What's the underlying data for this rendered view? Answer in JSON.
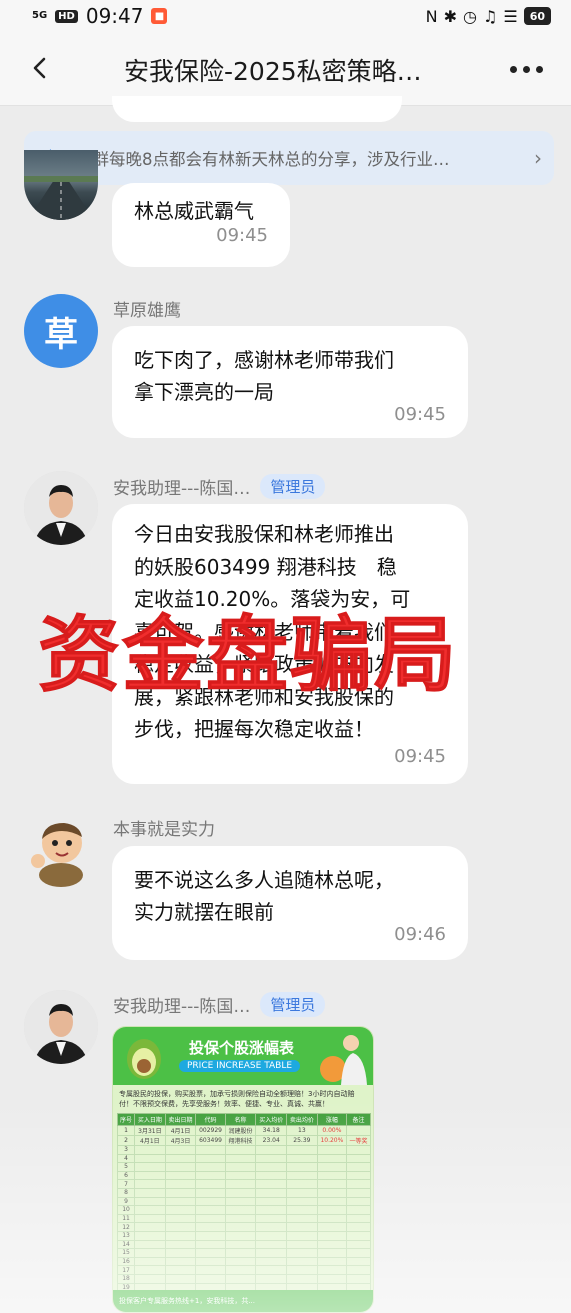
{
  "status_bar": {
    "network": "5G",
    "hd": "HD",
    "time": "09:47",
    "battery": "60"
  },
  "nav": {
    "title": "安我保险-2025私密策略…"
  },
  "notice": {
    "text": "本群每晚8点都会有林新天林总的分享，涉及行业…"
  },
  "messages": [
    {
      "text": "林总威武霸气",
      "time": "09:45"
    },
    {
      "sender": "草原雄鹰",
      "avatar_char": "草",
      "text": "吃下肉了，感谢林老师带我们\n拿下漂亮的一局",
      "time": "09:45"
    },
    {
      "sender": "安我助理---陈国…",
      "badge": "管理员",
      "text": "今日由安我股保和林老师推出\n的妖股603499 翔港科技　稳\n定收益10.20%。落袋为安，可\n喜可贺。感谢林老师带着我们\n稳定收益，紧跟政策的方向发\n展，紧跟林老师和安我股保的\n步伐，把握每次稳定收益！",
      "time": "09:45"
    },
    {
      "sender": "本事就是实力",
      "text": "要不说这么多人追随林总呢，\n实力就摆在眼前",
      "time": "09:46"
    },
    {
      "sender": "安我助理---陈国…",
      "badge": "管理员"
    }
  ],
  "stamp": "资金盘骗局",
  "image_card": {
    "title": "投保个股涨幅表",
    "subtitle": "PRICE INCREASE TABLE",
    "note": "专属股民的投保，购买股票，加承亏损则保险自动全额理赔！3小时内自动赔付！不限预交保费，先享受服务！效率、便捷、专业、真诚、共赢！",
    "columns": [
      "序号",
      "买入日期",
      "卖出日期",
      "代码",
      "名称",
      "买入均价",
      "卖出均价",
      "涨幅",
      "备注"
    ],
    "rows": [
      [
        "1",
        "3月31日",
        "4月1日",
        "002929",
        "润建股份",
        "34.18",
        "13",
        "0.00%",
        ""
      ],
      [
        "2",
        "4月1日",
        "4月3日",
        "603499",
        "翔港科技",
        "23.04",
        "25.39",
        "10.20%",
        "一等奖"
      ]
    ],
    "row_count": 22,
    "footer": "投保客户专属服务热线+1，安我科技，共..."
  }
}
